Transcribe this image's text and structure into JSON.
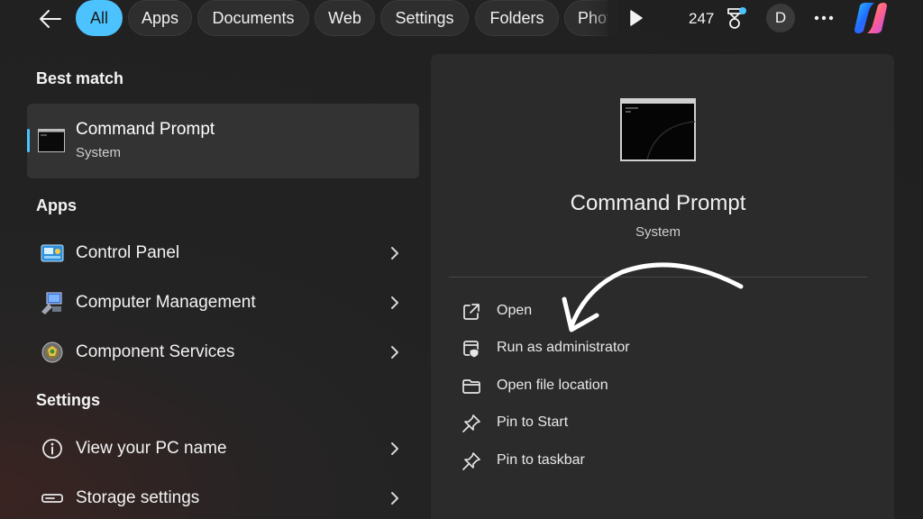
{
  "topbar": {
    "filters": [
      {
        "label": "All",
        "active": true
      },
      {
        "label": "Apps"
      },
      {
        "label": "Documents"
      },
      {
        "label": "Web"
      },
      {
        "label": "Settings"
      },
      {
        "label": "Folders"
      },
      {
        "label": "Photos"
      }
    ],
    "points": "247",
    "avatar_initial": "D",
    "accent_color": "#4cc2ff",
    "icons": [
      "back-arrow-icon",
      "play-icon",
      "rewards-icon",
      "more-icon",
      "copilot-icon"
    ]
  },
  "best_match": {
    "heading": "Best match",
    "title": "Command Prompt",
    "subtitle": "System",
    "icon": "command-prompt-icon"
  },
  "apps": {
    "heading": "Apps",
    "items": [
      {
        "label": "Control Panel",
        "icon": "control-panel-icon"
      },
      {
        "label": "Computer Management",
        "icon": "computer-management-icon"
      },
      {
        "label": "Component Services",
        "icon": "component-services-icon"
      }
    ]
  },
  "settings": {
    "heading": "Settings",
    "items": [
      {
        "label": "View your PC name",
        "icon": "info-icon"
      },
      {
        "label": "Storage settings",
        "icon": "storage-icon"
      }
    ]
  },
  "preview": {
    "title": "Command Prompt",
    "subtitle": "System",
    "actions": [
      {
        "label": "Open",
        "icon": "open-external-icon"
      },
      {
        "label": "Run as administrator",
        "icon": "admin-shield-icon"
      },
      {
        "label": "Open file location",
        "icon": "folder-icon"
      },
      {
        "label": "Pin to Start",
        "icon": "pin-icon"
      },
      {
        "label": "Pin to taskbar",
        "icon": "pin-icon"
      }
    ]
  }
}
